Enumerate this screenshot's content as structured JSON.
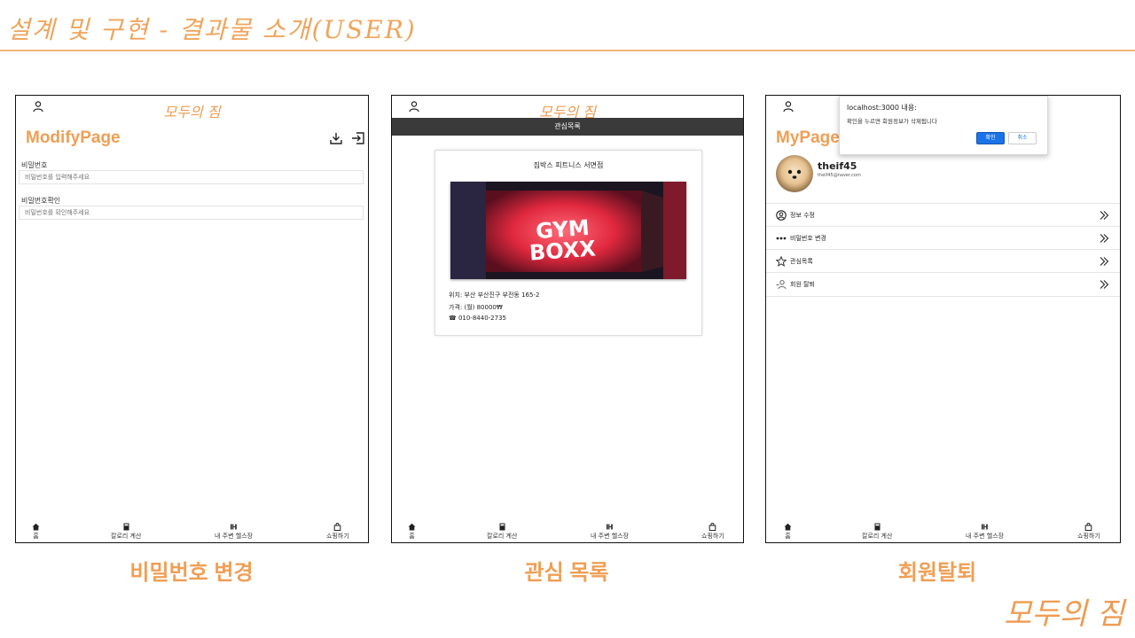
{
  "slide": {
    "title": "설계 및 구현 - 결과물 소개(USER)",
    "corner_logo": "모두의 짐",
    "accent_color": "#ef9f55"
  },
  "captions": [
    "비밀번호 변경",
    "관심 목록",
    "회원탈퇴"
  ],
  "app": {
    "brand": "모두의 짐"
  },
  "nav": {
    "home": "홈",
    "calorie": "칼로리 계산",
    "nearby": "내 주변 헬스장",
    "shop": "쇼핑하기"
  },
  "modify": {
    "heading": "ModifyPage",
    "pw_label": "비밀번호",
    "pw_placeholder": "비밀번호를 입력해주세요",
    "pw_confirm_label": "비밀번호확인",
    "pw_confirm_placeholder": "비밀번호를 확인해주세요"
  },
  "favorites": {
    "section_title": "관심목록",
    "gym_name": "짐박스 피트니스 서면점",
    "sign_text_1": "GYM",
    "sign_text_2": "BOXX",
    "location": "위치: 부산 부산진구 부전동 165-2",
    "price": "가격: (월) 80000₩",
    "phone": "☎ 010-8440-2735"
  },
  "mypage": {
    "heading": "MyPage",
    "username": "theif45",
    "email": "theif45@naver.com",
    "menu": [
      "정보 수정",
      "비밀번호 변경",
      "관심목록",
      "회원 탈퇴"
    ],
    "dialog": {
      "title": "localhost:3000 내용:",
      "message": "확인을 누르면 회원정보가 삭제됩니다",
      "ok": "확인",
      "cancel": "취소"
    }
  }
}
